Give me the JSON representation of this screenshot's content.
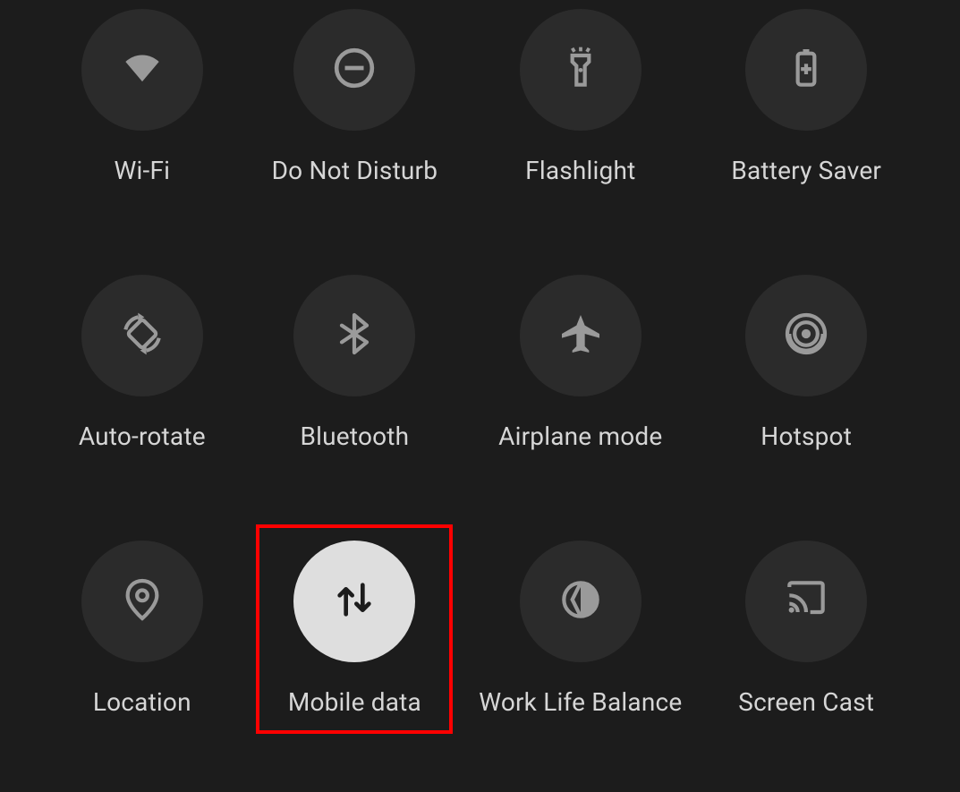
{
  "quick_settings": {
    "tiles": [
      {
        "id": "wifi",
        "label": "Wi-Fi",
        "icon": "wifi-icon",
        "active": false,
        "highlighted": false
      },
      {
        "id": "dnd",
        "label": "Do Not Disturb",
        "icon": "dnd-icon",
        "active": false,
        "highlighted": false
      },
      {
        "id": "flashlight",
        "label": "Flashlight",
        "icon": "flashlight-icon",
        "active": false,
        "highlighted": false
      },
      {
        "id": "battery-saver",
        "label": "Battery Saver",
        "icon": "battery-saver-icon",
        "active": false,
        "highlighted": false
      },
      {
        "id": "auto-rotate",
        "label": "Auto-rotate",
        "icon": "auto-rotate-icon",
        "active": false,
        "highlighted": false
      },
      {
        "id": "bluetooth",
        "label": "Bluetooth",
        "icon": "bluetooth-icon",
        "active": false,
        "highlighted": false
      },
      {
        "id": "airplane",
        "label": "Airplane mode",
        "icon": "airplane-icon",
        "active": false,
        "highlighted": false
      },
      {
        "id": "hotspot",
        "label": "Hotspot",
        "icon": "hotspot-icon",
        "active": false,
        "highlighted": false
      },
      {
        "id": "location",
        "label": "Location",
        "icon": "location-icon",
        "active": false,
        "highlighted": false
      },
      {
        "id": "mobile-data",
        "label": "Mobile data",
        "icon": "mobile-data-icon",
        "active": true,
        "highlighted": true
      },
      {
        "id": "work-life",
        "label": "Work Life Balance",
        "icon": "work-life-icon",
        "active": false,
        "highlighted": false
      },
      {
        "id": "screen-cast",
        "label": "Screen Cast",
        "icon": "screen-cast-icon",
        "active": false,
        "highlighted": false
      }
    ]
  }
}
